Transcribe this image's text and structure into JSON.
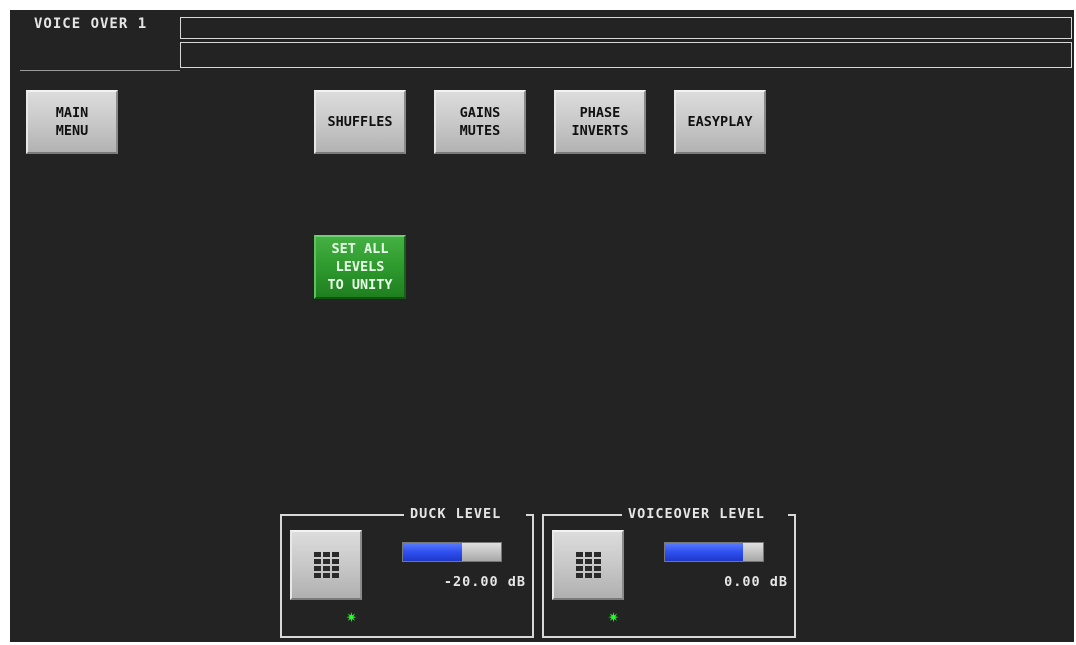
{
  "header": {
    "title": "VOICE OVER 1",
    "field1": "",
    "field2": ""
  },
  "nav": {
    "main_menu": "MAIN\nMENU",
    "shuffles": "SHUFFLES",
    "gains_mutes": "GAINS\nMUTES",
    "phase_inverts": "PHASE\nINVERTS",
    "easyplay": "EASYPLAY"
  },
  "actions": {
    "set_unity": "SET ALL\nLEVELS\nTO UNITY"
  },
  "levels": {
    "duck": {
      "label": "DUCK LEVEL",
      "value_text": "-20.00 dB",
      "fill_fraction": 0.6,
      "status_icon": "green-star-led"
    },
    "voiceover": {
      "label": "VOICEOVER LEVEL",
      "value_text": "0.00 dB",
      "fill_fraction": 0.8,
      "status_icon": "green-star-led"
    }
  },
  "colors": {
    "background": "#232323",
    "accent_green": "#2e9a2e",
    "bar_blue": "#2f50f0",
    "led_green": "#22ff22"
  }
}
